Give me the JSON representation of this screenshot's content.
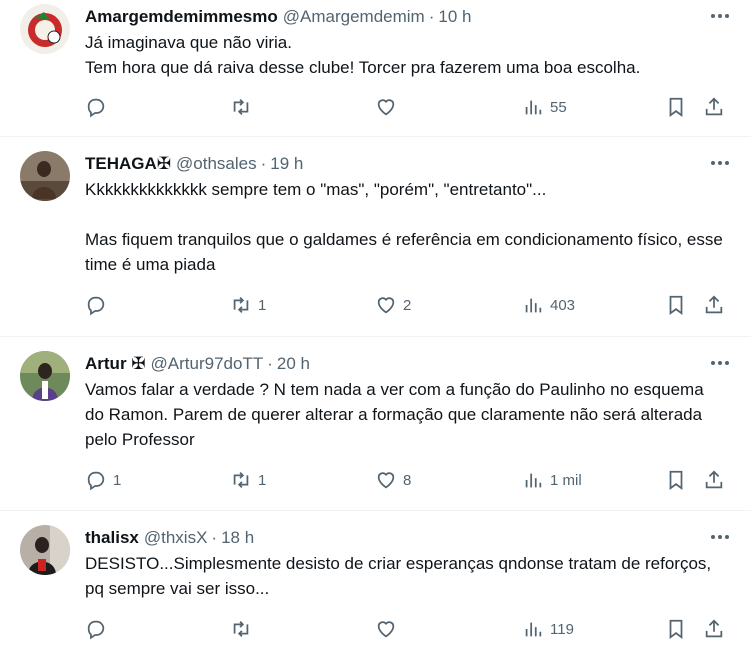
{
  "tweets": [
    {
      "name": "Amargemdemimmesmo",
      "handle": "@Amargemdemim",
      "dot": "·",
      "time": "10 h",
      "text": "Já imaginava que não viria.\nTem hora que dá raiva desse clube! Torcer pra fazerem uma boa escolha.",
      "replies": "",
      "retweets": "",
      "likes": "",
      "views": "55"
    },
    {
      "name": "TEHAGA✠",
      "handle": "@othsales",
      "dot": "·",
      "time": "19 h",
      "text": "Kkkkkkkkkkkkkk sempre tem o \"mas\", \"porém\", \"entretanto\"...\n\nMas fiquem tranquilos que o galdames é referência em condicionamento físico, esse time é uma piada",
      "replies": "",
      "retweets": "1",
      "likes": "2",
      "views": "403"
    },
    {
      "name": "Artur ✠",
      "handle": "@Artur97doTT",
      "dot": "·",
      "time": "20 h",
      "text": "Vamos falar a verdade ? N tem nada a ver com a função do Paulinho no esquema do Ramon. Parem de querer alterar a formação que claramente não será alterada pelo Professor",
      "replies": "1",
      "retweets": "1",
      "likes": "8",
      "views": "1 mil"
    },
    {
      "name": "thalisx",
      "handle": "@thxisX",
      "dot": "·",
      "time": "18 h",
      "text": "DESISTO...Simplesmente desisto de criar esperanças qndonse tratam de reforços, pq sempre vai ser isso...",
      "replies": "",
      "retweets": "",
      "likes": "",
      "views": "119"
    }
  ],
  "icons": {
    "reply": "reply-icon",
    "retweet": "retweet-icon",
    "like": "heart-icon",
    "views": "views-icon",
    "bookmark": "bookmark-icon",
    "share": "share-icon",
    "more": "more-icon"
  },
  "colors": {
    "text": "#0f1419",
    "secondary": "#536471",
    "divider": "#eff3f4"
  }
}
